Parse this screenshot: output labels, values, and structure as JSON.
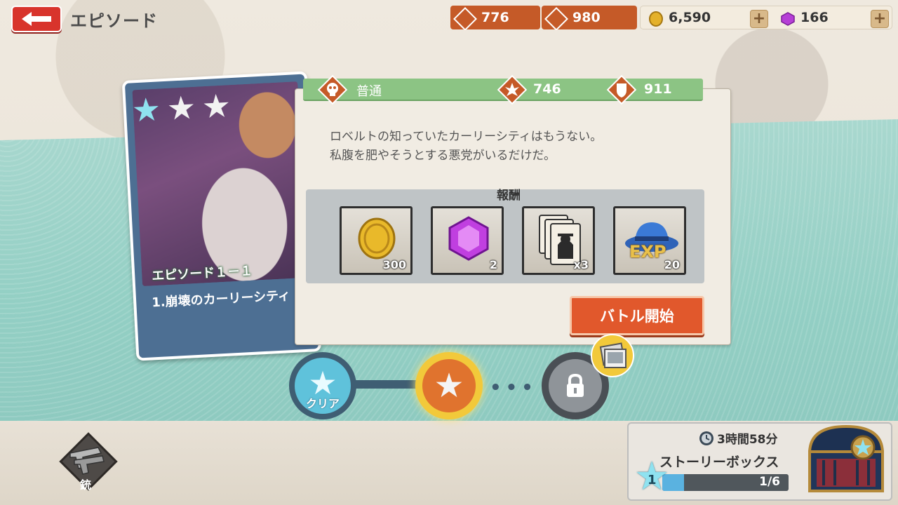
{
  "header": {
    "title": "エピソード",
    "attack": "776",
    "defense": "980",
    "coins": "6,590",
    "gems": "166"
  },
  "card": {
    "stars_filled": 1,
    "stars_total": 3,
    "episode": "エピソード１－１",
    "name": "1.崩壊のカーリーシティ"
  },
  "stage": {
    "difficulty": "普通",
    "attack": "746",
    "defense": "911",
    "description_line1": "ロベルトの知っていたカーリーシティはもうない。",
    "description_line2": "私腹を肥やそうとする悪党がいるだけだ。",
    "reward_title": "報酬",
    "rewards": [
      {
        "icon": "coin-icon",
        "count": "300"
      },
      {
        "icon": "gem-icon",
        "count": "2"
      },
      {
        "icon": "card-icon",
        "count": "x3"
      },
      {
        "icon": "exp-hat-icon",
        "count": "20",
        "label": "EXP"
      }
    ],
    "start_label": "バトル開始"
  },
  "progress": {
    "node1_label": "クリア"
  },
  "weapon": {
    "label": "銃"
  },
  "story_box": {
    "timer": "3時間58分",
    "title": "ストーリーボックス",
    "level": "1",
    "progress_text": "1/6",
    "progress_fraction": 0.17
  }
}
